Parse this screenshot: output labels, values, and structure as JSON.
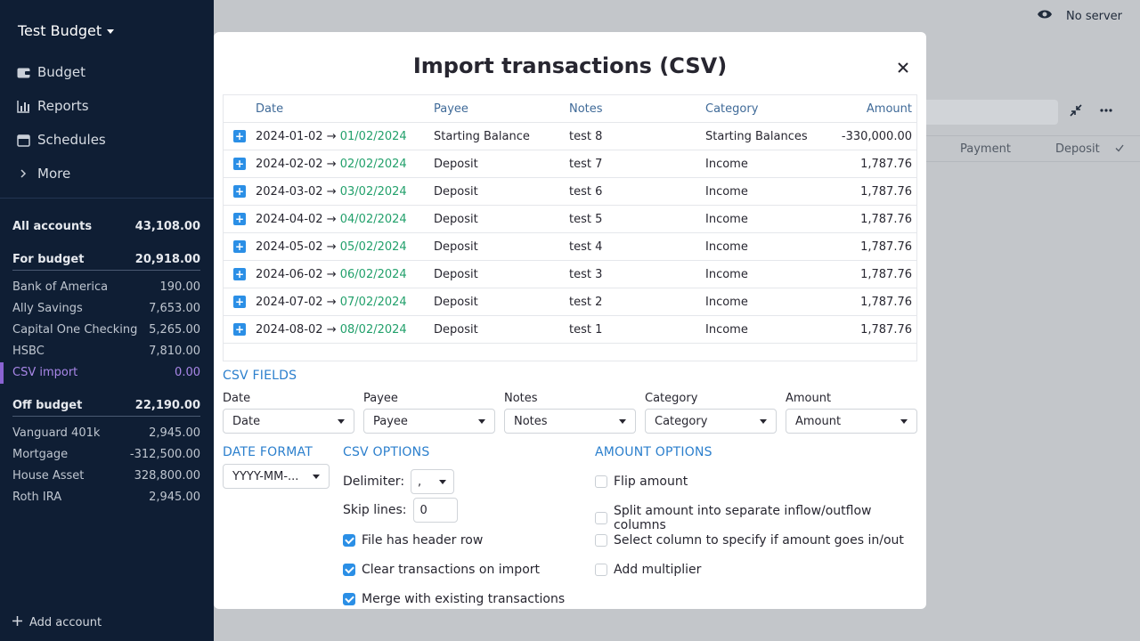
{
  "sidebar": {
    "budget_name": "Test Budget",
    "nav": [
      {
        "label": "Budget",
        "icon": "wallet-icon"
      },
      {
        "label": "Reports",
        "icon": "chart-icon"
      },
      {
        "label": "Schedules",
        "icon": "calendar-icon"
      },
      {
        "label": "More",
        "icon": "chevron-right-icon"
      }
    ],
    "all_accounts": {
      "label": "All accounts",
      "value": "43,108.00"
    },
    "for_budget": {
      "label": "For budget",
      "value": "20,918.00"
    },
    "budget_accounts": [
      {
        "name": "Bank of America",
        "value": "190.00"
      },
      {
        "name": "Ally Savings",
        "value": "7,653.00"
      },
      {
        "name": "Capital One Checking",
        "value": "5,265.00"
      },
      {
        "name": "HSBC",
        "value": "7,810.00"
      },
      {
        "name": "CSV import",
        "value": "0.00",
        "selected": true
      }
    ],
    "off_budget": {
      "label": "Off budget",
      "value": "22,190.00"
    },
    "off_budget_accounts": [
      {
        "name": "Vanguard 401k",
        "value": "2,945.00"
      },
      {
        "name": "Mortgage",
        "value": "-312,500.00"
      },
      {
        "name": "House Asset",
        "value": "328,800.00"
      },
      {
        "name": "Roth IRA",
        "value": "2,945.00"
      }
    ],
    "add_account": "Add account"
  },
  "topbar": {
    "server_status": "No server"
  },
  "background_table": {
    "payment": "Payment",
    "deposit": "Deposit"
  },
  "modal": {
    "title": "Import transactions (CSV)",
    "columns": {
      "date": "Date",
      "payee": "Payee",
      "notes": "Notes",
      "category": "Category",
      "amount": "Amount"
    },
    "rows": [
      {
        "date_raw": "2024-01-02",
        "arrow": "→",
        "date_parsed": "01/02/2024",
        "payee": "Starting Balance",
        "notes": "test 8",
        "category": "Starting Balances",
        "amount": "-330,000.00"
      },
      {
        "date_raw": "2024-02-02",
        "arrow": "→",
        "date_parsed": "02/02/2024",
        "payee": "Deposit",
        "notes": "test 7",
        "category": "Income",
        "amount": "1,787.76"
      },
      {
        "date_raw": "2024-03-02",
        "arrow": "→",
        "date_parsed": "03/02/2024",
        "payee": "Deposit",
        "notes": "test 6",
        "category": "Income",
        "amount": "1,787.76"
      },
      {
        "date_raw": "2024-04-02",
        "arrow": "→",
        "date_parsed": "04/02/2024",
        "payee": "Deposit",
        "notes": "test 5",
        "category": "Income",
        "amount": "1,787.76"
      },
      {
        "date_raw": "2024-05-02",
        "arrow": "→",
        "date_parsed": "05/02/2024",
        "payee": "Deposit",
        "notes": "test 4",
        "category": "Income",
        "amount": "1,787.76"
      },
      {
        "date_raw": "2024-06-02",
        "arrow": "→",
        "date_parsed": "06/02/2024",
        "payee": "Deposit",
        "notes": "test 3",
        "category": "Income",
        "amount": "1,787.76"
      },
      {
        "date_raw": "2024-07-02",
        "arrow": "→",
        "date_parsed": "07/02/2024",
        "payee": "Deposit",
        "notes": "test 2",
        "category": "Income",
        "amount": "1,787.76"
      },
      {
        "date_raw": "2024-08-02",
        "arrow": "→",
        "date_parsed": "08/02/2024",
        "payee": "Deposit",
        "notes": "test 1",
        "category": "Income",
        "amount": "1,787.76"
      }
    ],
    "csv_fields": {
      "heading": "CSV FIELDS",
      "fields": [
        {
          "label": "Date",
          "value": "Date"
        },
        {
          "label": "Payee",
          "value": "Payee"
        },
        {
          "label": "Notes",
          "value": "Notes"
        },
        {
          "label": "Category",
          "value": "Category"
        },
        {
          "label": "Amount",
          "value": "Amount"
        }
      ]
    },
    "date_format": {
      "heading": "DATE FORMAT",
      "value": "YYYY-MM-..."
    },
    "csv_options": {
      "heading": "CSV OPTIONS",
      "delimiter_label": "Delimiter:",
      "delimiter_value": ",",
      "skip_lines_label": "Skip lines:",
      "skip_lines_value": "0",
      "header_row": {
        "label": "File has header row",
        "checked": true
      },
      "clear_tx": {
        "label": "Clear transactions on import",
        "checked": true
      },
      "merge": {
        "label": "Merge with existing transactions",
        "checked": true
      }
    },
    "amount_options": {
      "heading": "AMOUNT OPTIONS",
      "flip": {
        "label": "Flip amount",
        "checked": false
      },
      "split": {
        "label": "Split amount into separate inflow/outflow columns",
        "checked": false
      },
      "select_col": {
        "label": "Select column to specify if amount goes in/out",
        "checked": false
      },
      "multiplier": {
        "label": "Add multiplier",
        "checked": false
      }
    }
  },
  "colors": {
    "accent": "#2b8fe6",
    "heading_blue": "#2b7fcd",
    "date_green": "#22a06b",
    "sidebar_bg": "#0f1e34",
    "selected_purple": "#8a63d2"
  }
}
